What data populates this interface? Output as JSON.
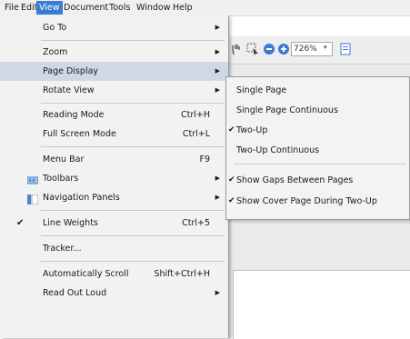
{
  "menubar": {
    "items": [
      "File",
      "Edit",
      "View",
      "Document",
      "Tools",
      "Window",
      "Help"
    ]
  },
  "toolbar": {
    "zoom_value": "726%",
    "icons": [
      "hand-tool-icon",
      "select-tool-icon",
      "zoom-out-icon",
      "zoom-in-icon",
      "single-page-view-icon"
    ]
  },
  "view_menu": {
    "items": [
      {
        "label": "Go To"
      },
      {
        "label": "Zoom"
      },
      {
        "label": "Page Display"
      },
      {
        "label": "Rotate View"
      },
      {
        "label": "Reading Mode",
        "shortcut": "Ctrl+H"
      },
      {
        "label": "Full Screen Mode",
        "shortcut": "Ctrl+L"
      },
      {
        "label": "Menu Bar",
        "shortcut": "F9"
      },
      {
        "label": "Toolbars"
      },
      {
        "label": "Navigation Panels"
      },
      {
        "label": "Line Weights",
        "shortcut": "Ctrl+5"
      },
      {
        "label": "Tracker..."
      },
      {
        "label": "Automatically Scroll",
        "shortcut": "Shift+Ctrl+H"
      },
      {
        "label": "Read Out Loud"
      }
    ]
  },
  "page_display_submenu": {
    "items": [
      {
        "label": "Single Page"
      },
      {
        "label": "Single Page Continuous"
      },
      {
        "label": "Two-Up"
      },
      {
        "label": "Two-Up Continuous"
      },
      {
        "label": "Show Gaps Between Pages"
      },
      {
        "label": "Show Cover Page During Two-Up"
      }
    ]
  },
  "colors": {
    "menubar_active": "#3a7bd5",
    "menu_highlight": "#cfd9e6",
    "menu_background": "#f2f2f2"
  }
}
